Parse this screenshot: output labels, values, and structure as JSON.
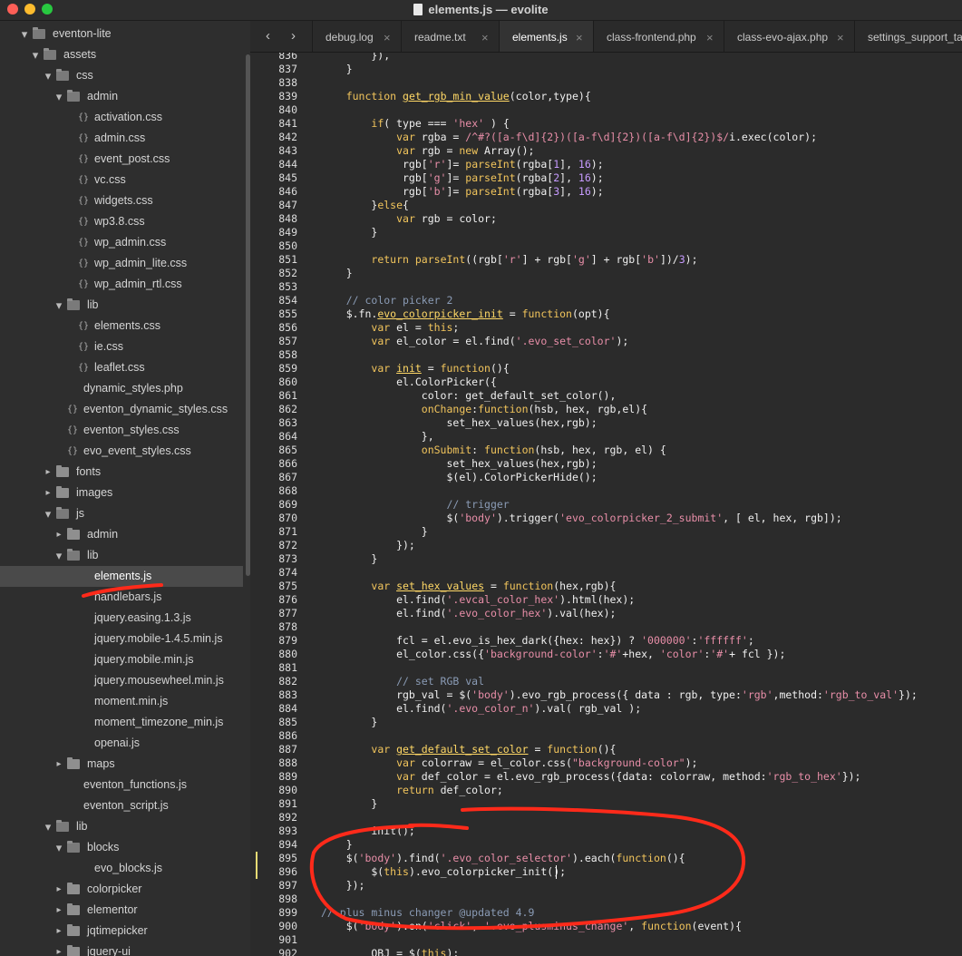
{
  "window": {
    "title": "elements.js — evolite"
  },
  "colors": {
    "accent": "#ff2a1a",
    "background": "#2b2b2b",
    "keyword": "#f2c55c",
    "string": "#e88ea8",
    "number": "#c79bff",
    "comment": "#8a9bb5"
  },
  "sidebar": {
    "tree": [
      {
        "label": "eventon-lite",
        "depth": 0,
        "kind": "folder",
        "open": true
      },
      {
        "label": "assets",
        "depth": 1,
        "kind": "folder",
        "open": true
      },
      {
        "label": "css",
        "depth": 2,
        "kind": "folder",
        "open": true
      },
      {
        "label": "admin",
        "depth": 3,
        "kind": "folder",
        "open": true
      },
      {
        "label": "activation.css",
        "depth": 4,
        "kind": "file"
      },
      {
        "label": "admin.css",
        "depth": 4,
        "kind": "file"
      },
      {
        "label": "event_post.css",
        "depth": 4,
        "kind": "file"
      },
      {
        "label": "vc.css",
        "depth": 4,
        "kind": "file"
      },
      {
        "label": "widgets.css",
        "depth": 4,
        "kind": "file"
      },
      {
        "label": "wp3.8.css",
        "depth": 4,
        "kind": "file"
      },
      {
        "label": "wp_admin.css",
        "depth": 4,
        "kind": "file"
      },
      {
        "label": "wp_admin_lite.css",
        "depth": 4,
        "kind": "file"
      },
      {
        "label": "wp_admin_rtl.css",
        "depth": 4,
        "kind": "file"
      },
      {
        "label": "lib",
        "depth": 3,
        "kind": "folder",
        "open": true
      },
      {
        "label": "elements.css",
        "depth": 4,
        "kind": "file"
      },
      {
        "label": "ie.css",
        "depth": 4,
        "kind": "file"
      },
      {
        "label": "leaflet.css",
        "depth": 4,
        "kind": "file"
      },
      {
        "label": "dynamic_styles.php",
        "depth": 3,
        "kind": "plain"
      },
      {
        "label": "eventon_dynamic_styles.css",
        "depth": 3,
        "kind": "file"
      },
      {
        "label": "eventon_styles.css",
        "depth": 3,
        "kind": "file"
      },
      {
        "label": "evo_event_styles.css",
        "depth": 3,
        "kind": "file"
      },
      {
        "label": "fonts",
        "depth": 2,
        "kind": "folder",
        "open": false
      },
      {
        "label": "images",
        "depth": 2,
        "kind": "folder",
        "open": false
      },
      {
        "label": "js",
        "depth": 2,
        "kind": "folder",
        "open": true
      },
      {
        "label": "admin",
        "depth": 3,
        "kind": "folder",
        "open": false
      },
      {
        "label": "lib",
        "depth": 3,
        "kind": "folder",
        "open": true
      },
      {
        "label": "elements.js",
        "depth": 4,
        "kind": "plain",
        "selected": true
      },
      {
        "label": "handlebars.js",
        "depth": 4,
        "kind": "plain"
      },
      {
        "label": "jquery.easing.1.3.js",
        "depth": 4,
        "kind": "plain"
      },
      {
        "label": "jquery.mobile-1.4.5.min.js",
        "depth": 4,
        "kind": "plain"
      },
      {
        "label": "jquery.mobile.min.js",
        "depth": 4,
        "kind": "plain"
      },
      {
        "label": "jquery.mousewheel.min.js",
        "depth": 4,
        "kind": "plain"
      },
      {
        "label": "moment.min.js",
        "depth": 4,
        "kind": "plain"
      },
      {
        "label": "moment_timezone_min.js",
        "depth": 4,
        "kind": "plain"
      },
      {
        "label": "openai.js",
        "depth": 4,
        "kind": "plain"
      },
      {
        "label": "maps",
        "depth": 3,
        "kind": "folder",
        "open": false
      },
      {
        "label": "eventon_functions.js",
        "depth": 3,
        "kind": "plain"
      },
      {
        "label": "eventon_script.js",
        "depth": 3,
        "kind": "plain"
      },
      {
        "label": "lib",
        "depth": 2,
        "kind": "folder",
        "open": true
      },
      {
        "label": "blocks",
        "depth": 3,
        "kind": "folder",
        "open": true
      },
      {
        "label": "evo_blocks.js",
        "depth": 4,
        "kind": "plain"
      },
      {
        "label": "colorpicker",
        "depth": 3,
        "kind": "folder",
        "open": false
      },
      {
        "label": "elementor",
        "depth": 3,
        "kind": "folder",
        "open": false
      },
      {
        "label": "jqtimepicker",
        "depth": 3,
        "kind": "folder",
        "open": false
      },
      {
        "label": "jquery-ui",
        "depth": 3,
        "kind": "folder",
        "open": false
      }
    ]
  },
  "tabs": [
    {
      "label": "debug.log",
      "active": false
    },
    {
      "label": "readme.txt",
      "active": false
    },
    {
      "label": "elements.js",
      "active": true
    },
    {
      "label": "class-frontend.php",
      "active": false
    },
    {
      "label": "class-evo-ajax.php",
      "active": false
    },
    {
      "label": "settings_support_ta",
      "active": false
    }
  ],
  "tab_close_glyph": "×",
  "editor": {
    "first_line": 836,
    "cursor": {
      "line": 896,
      "col": 37
    },
    "modified_lines": [
      895,
      896
    ],
    "lines": [
      [
        [
          "p",
          "        }),"
        ]
      ],
      [
        [
          "p",
          "    }"
        ]
      ],
      [
        [
          "p",
          ""
        ]
      ],
      [
        [
          "p",
          "    "
        ],
        [
          "k",
          "function"
        ],
        [
          "p",
          " "
        ],
        [
          "fn",
          "get_rgb_min_value"
        ],
        [
          "p",
          "(color,type){"
        ]
      ],
      [
        [
          "p",
          ""
        ]
      ],
      [
        [
          "p",
          "        "
        ],
        [
          "k",
          "if"
        ],
        [
          "p",
          "( type === "
        ],
        [
          "s",
          "'hex'"
        ],
        [
          "p",
          " ) {"
        ]
      ],
      [
        [
          "p",
          "            "
        ],
        [
          "k",
          "var"
        ],
        [
          "p",
          " rgba = "
        ],
        [
          "r",
          "/^#?([a-f\\d]{2})([a-f\\d]{2})([a-f\\d]{2})$/"
        ],
        [
          "p",
          "i.exec(color);"
        ]
      ],
      [
        [
          "p",
          "            "
        ],
        [
          "k",
          "var"
        ],
        [
          "p",
          " rgb = "
        ],
        [
          "k",
          "new"
        ],
        [
          "p",
          " Array();"
        ]
      ],
      [
        [
          "p",
          "             rgb["
        ],
        [
          "s",
          "'r'"
        ],
        [
          "p",
          "]= "
        ],
        [
          "f",
          "parseInt"
        ],
        [
          "p",
          "(rgba["
        ],
        [
          "n",
          "1"
        ],
        [
          "p",
          "], "
        ],
        [
          "n",
          "16"
        ],
        [
          "p",
          ");"
        ]
      ],
      [
        [
          "p",
          "             rgb["
        ],
        [
          "s",
          "'g'"
        ],
        [
          "p",
          "]= "
        ],
        [
          "f",
          "parseInt"
        ],
        [
          "p",
          "(rgba["
        ],
        [
          "n",
          "2"
        ],
        [
          "p",
          "], "
        ],
        [
          "n",
          "16"
        ],
        [
          "p",
          ");"
        ]
      ],
      [
        [
          "p",
          "             rgb["
        ],
        [
          "s",
          "'b'"
        ],
        [
          "p",
          "]= "
        ],
        [
          "f",
          "parseInt"
        ],
        [
          "p",
          "(rgba["
        ],
        [
          "n",
          "3"
        ],
        [
          "p",
          "], "
        ],
        [
          "n",
          "16"
        ],
        [
          "p",
          ");"
        ]
      ],
      [
        [
          "p",
          "        }"
        ],
        [
          "k",
          "else"
        ],
        [
          "p",
          "{"
        ]
      ],
      [
        [
          "p",
          "            "
        ],
        [
          "k",
          "var"
        ],
        [
          "p",
          " rgb = color;"
        ]
      ],
      [
        [
          "p",
          "        }"
        ]
      ],
      [
        [
          "p",
          ""
        ]
      ],
      [
        [
          "p",
          "        "
        ],
        [
          "k",
          "return"
        ],
        [
          "p",
          " "
        ],
        [
          "f",
          "parseInt"
        ],
        [
          "p",
          "((rgb["
        ],
        [
          "s",
          "'r'"
        ],
        [
          "p",
          "] + rgb["
        ],
        [
          "s",
          "'g'"
        ],
        [
          "p",
          "] + rgb["
        ],
        [
          "s",
          "'b'"
        ],
        [
          "p",
          "])/"
        ],
        [
          "n",
          "3"
        ],
        [
          "p",
          ");"
        ]
      ],
      [
        [
          "p",
          "    }"
        ]
      ],
      [
        [
          "p",
          ""
        ]
      ],
      [
        [
          "p",
          "    "
        ],
        [
          "c",
          "// color picker 2"
        ]
      ],
      [
        [
          "p",
          "    $.fn."
        ],
        [
          "fn",
          "evo_colorpicker_init"
        ],
        [
          "p",
          " = "
        ],
        [
          "k",
          "function"
        ],
        [
          "p",
          "(opt){"
        ]
      ],
      [
        [
          "p",
          "        "
        ],
        [
          "k",
          "var"
        ],
        [
          "p",
          " el = "
        ],
        [
          "k",
          "this"
        ],
        [
          "p",
          ";"
        ]
      ],
      [
        [
          "p",
          "        "
        ],
        [
          "k",
          "var"
        ],
        [
          "p",
          " el_color = el.find("
        ],
        [
          "s",
          "'.evo_set_color'"
        ],
        [
          "p",
          ");"
        ]
      ],
      [
        [
          "p",
          ""
        ]
      ],
      [
        [
          "p",
          "        "
        ],
        [
          "k",
          "var"
        ],
        [
          "p",
          " "
        ],
        [
          "fn",
          "init"
        ],
        [
          "p",
          " = "
        ],
        [
          "k",
          "function"
        ],
        [
          "p",
          "(){"
        ]
      ],
      [
        [
          "p",
          "            el.ColorPicker({"
        ]
      ],
      [
        [
          "p",
          "                color: get_default_set_color(),"
        ]
      ],
      [
        [
          "p",
          "                "
        ],
        [
          "f",
          "onChange"
        ],
        [
          "p",
          ":"
        ],
        [
          "k",
          "function"
        ],
        [
          "p",
          "(hsb, hex, rgb,el){"
        ]
      ],
      [
        [
          "p",
          "                    set_hex_values(hex,rgb);"
        ]
      ],
      [
        [
          "p",
          "                },"
        ]
      ],
      [
        [
          "p",
          "                "
        ],
        [
          "f",
          "onSubmit"
        ],
        [
          "p",
          ": "
        ],
        [
          "k",
          "function"
        ],
        [
          "p",
          "(hsb, hex, rgb, el) {"
        ]
      ],
      [
        [
          "p",
          "                    set_hex_values(hex,rgb);"
        ]
      ],
      [
        [
          "p",
          "                    $(el).ColorPickerHide();"
        ]
      ],
      [
        [
          "p",
          ""
        ]
      ],
      [
        [
          "p",
          "                    "
        ],
        [
          "c",
          "// trigger"
        ]
      ],
      [
        [
          "p",
          "                    $("
        ],
        [
          "s",
          "'body'"
        ],
        [
          "p",
          ").trigger("
        ],
        [
          "s",
          "'evo_colorpicker_2_submit'"
        ],
        [
          "p",
          ", [ el, hex, rgb]);"
        ]
      ],
      [
        [
          "p",
          "                }"
        ]
      ],
      [
        [
          "p",
          "            });"
        ]
      ],
      [
        [
          "p",
          "        }"
        ]
      ],
      [
        [
          "p",
          ""
        ]
      ],
      [
        [
          "p",
          "        "
        ],
        [
          "k",
          "var"
        ],
        [
          "p",
          " "
        ],
        [
          "fn",
          "set_hex_values"
        ],
        [
          "p",
          " = "
        ],
        [
          "k",
          "function"
        ],
        [
          "p",
          "(hex,rgb){"
        ]
      ],
      [
        [
          "p",
          "            el.find("
        ],
        [
          "s",
          "'.evcal_color_hex'"
        ],
        [
          "p",
          ").html(hex);"
        ]
      ],
      [
        [
          "p",
          "            el.find("
        ],
        [
          "s",
          "'.evo_color_hex'"
        ],
        [
          "p",
          ").val(hex);"
        ]
      ],
      [
        [
          "p",
          ""
        ]
      ],
      [
        [
          "p",
          "            fcl = el.evo_is_hex_dark({hex: hex}) ? "
        ],
        [
          "s",
          "'000000'"
        ],
        [
          "p",
          ":"
        ],
        [
          "s",
          "'ffffff'"
        ],
        [
          "p",
          ";"
        ]
      ],
      [
        [
          "p",
          "            el_color.css({"
        ],
        [
          "s",
          "'background-color'"
        ],
        [
          "p",
          ":"
        ],
        [
          "s",
          "'#'"
        ],
        [
          "p",
          "+hex, "
        ],
        [
          "s",
          "'color'"
        ],
        [
          "p",
          ":"
        ],
        [
          "s",
          "'#'"
        ],
        [
          "p",
          "+ fcl });"
        ]
      ],
      [
        [
          "p",
          ""
        ]
      ],
      [
        [
          "p",
          "            "
        ],
        [
          "c",
          "// set RGB val"
        ]
      ],
      [
        [
          "p",
          "            rgb_val = $("
        ],
        [
          "s",
          "'body'"
        ],
        [
          "p",
          ").evo_rgb_process({ data : rgb, type:"
        ],
        [
          "s",
          "'rgb'"
        ],
        [
          "p",
          ",method:"
        ],
        [
          "s",
          "'rgb_to_val'"
        ],
        [
          "p",
          "});"
        ]
      ],
      [
        [
          "p",
          "            el.find("
        ],
        [
          "s",
          "'.evo_color_n'"
        ],
        [
          "p",
          ").val( rgb_val );"
        ]
      ],
      [
        [
          "p",
          "        }"
        ]
      ],
      [
        [
          "p",
          ""
        ]
      ],
      [
        [
          "p",
          "        "
        ],
        [
          "k",
          "var"
        ],
        [
          "p",
          " "
        ],
        [
          "fn",
          "get_default_set_color"
        ],
        [
          "p",
          " = "
        ],
        [
          "k",
          "function"
        ],
        [
          "p",
          "(){"
        ]
      ],
      [
        [
          "p",
          "            "
        ],
        [
          "k",
          "var"
        ],
        [
          "p",
          " colorraw = el_color.css("
        ],
        [
          "s",
          "\"background-color\""
        ],
        [
          "p",
          ");"
        ]
      ],
      [
        [
          "p",
          "            "
        ],
        [
          "k",
          "var"
        ],
        [
          "p",
          " def_color = el.evo_rgb_process({data: colorraw, method:"
        ],
        [
          "s",
          "'rgb_to_hex'"
        ],
        [
          "p",
          "});"
        ]
      ],
      [
        [
          "p",
          "            "
        ],
        [
          "k",
          "return"
        ],
        [
          "p",
          " def_color;"
        ]
      ],
      [
        [
          "p",
          "        }"
        ]
      ],
      [
        [
          "p",
          ""
        ]
      ],
      [
        [
          "p",
          "        init();"
        ]
      ],
      [
        [
          "p",
          "    }"
        ]
      ],
      [
        [
          "p",
          "    $("
        ],
        [
          "s",
          "'body'"
        ],
        [
          "p",
          ").find("
        ],
        [
          "s",
          "'.evo_color_selector'"
        ],
        [
          "p",
          ").each("
        ],
        [
          "k",
          "function"
        ],
        [
          "p",
          "(){"
        ]
      ],
      [
        [
          "p",
          "        $("
        ],
        [
          "k",
          "this"
        ],
        [
          "p",
          ").evo_colorpicker_init();"
        ]
      ],
      [
        [
          "p",
          "    });"
        ]
      ],
      [
        [
          "p",
          ""
        ]
      ],
      [
        [
          "c",
          "// plus minus changer @updated 4.9"
        ]
      ],
      [
        [
          "p",
          "    $("
        ],
        [
          "s",
          "'body'"
        ],
        [
          "p",
          ").on("
        ],
        [
          "s",
          "'click'"
        ],
        [
          "p",
          ", "
        ],
        [
          "s",
          "'.evo_plusminus_change'"
        ],
        [
          "p",
          ", "
        ],
        [
          "k",
          "function"
        ],
        [
          "p",
          "(event){"
        ]
      ],
      [
        [
          "p",
          ""
        ]
      ],
      [
        [
          "p",
          "        OBJ = $("
        ],
        [
          "k",
          "this"
        ],
        [
          "p",
          ");"
        ]
      ]
    ]
  }
}
